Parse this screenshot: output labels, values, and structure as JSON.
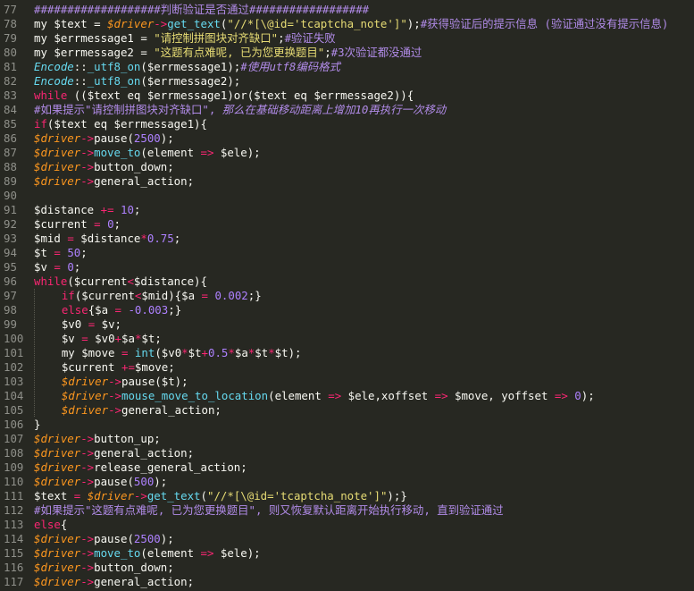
{
  "editor": {
    "colors": {
      "background": "#272822",
      "gutter_text": "#8f908a",
      "plain": "#f8f8f2",
      "keyword": "#f92672",
      "variable": "#fd971f",
      "string": "#e6db74",
      "number": "#ae81ff",
      "function": "#66d9ef",
      "comment": "#b18be8"
    },
    "lines": [
      {
        "n": "77",
        "tokens": [
          [
            "cm",
            "###################判断验证是否通过##################"
          ]
        ]
      },
      {
        "n": "78",
        "tokens": [
          [
            "plain",
            "my $text = "
          ],
          [
            "var",
            "$driver"
          ],
          [
            "kw",
            "->"
          ],
          [
            "fn",
            "get_text"
          ],
          [
            "plain",
            "("
          ],
          [
            "str",
            "\"//*[\\@id='tcaptcha_note']\""
          ],
          [
            "plain",
            ");"
          ],
          [
            "cm",
            "#获得验证后的提示信息 (验证通过没有提示信息)"
          ]
        ]
      },
      {
        "n": "79",
        "tokens": [
          [
            "plain",
            "my $errmessage1 = "
          ],
          [
            "str",
            "\"请控制拼图块对齐缺口\""
          ],
          [
            "plain",
            ";"
          ],
          [
            "cm",
            "#验证失败"
          ]
        ]
      },
      {
        "n": "80",
        "tokens": [
          [
            "plain",
            "my $errmessage2 = "
          ],
          [
            "str",
            "\"这题有点难呢, 已为您更换题目\""
          ],
          [
            "plain",
            ";"
          ],
          [
            "cm",
            "#3次验证都没通过"
          ]
        ]
      },
      {
        "n": "81",
        "tokens": [
          [
            "cls",
            "Encode"
          ],
          [
            "plain",
            "::"
          ],
          [
            "fn",
            "_utf8_on"
          ],
          [
            "plain",
            "($errmessage1);"
          ],
          [
            "cmi",
            "#使用utf8编码格式"
          ]
        ]
      },
      {
        "n": "82",
        "tokens": [
          [
            "cls",
            "Encode"
          ],
          [
            "plain",
            "::"
          ],
          [
            "fn",
            "_utf8_on"
          ],
          [
            "plain",
            "($errmessage2);"
          ]
        ]
      },
      {
        "n": "83",
        "tokens": [
          [
            "kw",
            "while"
          ],
          [
            "plain",
            " (($text eq $errmessage1)or($text eq $errmessage2)){"
          ]
        ]
      },
      {
        "n": "84",
        "tokens": [
          [
            "cm",
            "#如果提示\"请控制拼图块对齐缺口\", "
          ],
          [
            "cmi",
            "那么在基础移动距离上增加10再执行一次移动"
          ]
        ]
      },
      {
        "n": "85",
        "tokens": [
          [
            "kw",
            "if"
          ],
          [
            "plain",
            "($text eq $errmessage1){"
          ]
        ]
      },
      {
        "n": "86",
        "tokens": [
          [
            "var",
            "$driver"
          ],
          [
            "kw",
            "->"
          ],
          [
            "plain",
            "pause("
          ],
          [
            "num",
            "2500"
          ],
          [
            "plain",
            ");"
          ]
        ]
      },
      {
        "n": "87",
        "tokens": [
          [
            "var",
            "$driver"
          ],
          [
            "kw",
            "->"
          ],
          [
            "fn",
            "move_to"
          ],
          [
            "plain",
            "(element "
          ],
          [
            "kw",
            "=>"
          ],
          [
            "plain",
            " $ele);"
          ]
        ]
      },
      {
        "n": "88",
        "tokens": [
          [
            "var",
            "$driver"
          ],
          [
            "kw",
            "->"
          ],
          [
            "plain",
            "button_down;"
          ]
        ]
      },
      {
        "n": "89",
        "tokens": [
          [
            "var",
            "$driver"
          ],
          [
            "kw",
            "->"
          ],
          [
            "plain",
            "general_action;"
          ]
        ]
      },
      {
        "n": "90",
        "tokens": []
      },
      {
        "n": "91",
        "tokens": [
          [
            "plain",
            "$distance "
          ],
          [
            "kw",
            "+="
          ],
          [
            "plain",
            " "
          ],
          [
            "num",
            "10"
          ],
          [
            "plain",
            ";"
          ]
        ]
      },
      {
        "n": "92",
        "tokens": [
          [
            "plain",
            "$current "
          ],
          [
            "kw",
            "="
          ],
          [
            "plain",
            " "
          ],
          [
            "num",
            "0"
          ],
          [
            "plain",
            ";"
          ]
        ]
      },
      {
        "n": "93",
        "tokens": [
          [
            "plain",
            "$mid "
          ],
          [
            "kw",
            "="
          ],
          [
            "plain",
            " $distance"
          ],
          [
            "kw",
            "*"
          ],
          [
            "num",
            "0.75"
          ],
          [
            "plain",
            ";"
          ]
        ]
      },
      {
        "n": "94",
        "tokens": [
          [
            "plain",
            "$t "
          ],
          [
            "kw",
            "="
          ],
          [
            "plain",
            " "
          ],
          [
            "num",
            "50"
          ],
          [
            "plain",
            ";"
          ]
        ]
      },
      {
        "n": "95",
        "tokens": [
          [
            "plain",
            "$v "
          ],
          [
            "kw",
            "="
          ],
          [
            "plain",
            " "
          ],
          [
            "num",
            "0"
          ],
          [
            "plain",
            ";"
          ]
        ]
      },
      {
        "n": "96",
        "tokens": [
          [
            "kw",
            "while"
          ],
          [
            "plain",
            "($current"
          ],
          [
            "kw",
            "<"
          ],
          [
            "plain",
            "$distance){"
          ]
        ]
      },
      {
        "n": "97",
        "indent": 1,
        "tokens": [
          [
            "kw",
            "if"
          ],
          [
            "plain",
            "($current"
          ],
          [
            "kw",
            "<"
          ],
          [
            "plain",
            "$mid){$a "
          ],
          [
            "kw",
            "="
          ],
          [
            "plain",
            " "
          ],
          [
            "num",
            "0.002"
          ],
          [
            "plain",
            ";}"
          ]
        ]
      },
      {
        "n": "98",
        "indent": 1,
        "tokens": [
          [
            "kw",
            "else"
          ],
          [
            "plain",
            "{$a "
          ],
          [
            "kw",
            "="
          ],
          [
            "plain",
            " "
          ],
          [
            "num",
            "-0.003"
          ],
          [
            "plain",
            ";}"
          ]
        ]
      },
      {
        "n": "99",
        "indent": 1,
        "tokens": [
          [
            "plain",
            "$v0 "
          ],
          [
            "kw",
            "="
          ],
          [
            "plain",
            " $v;"
          ]
        ]
      },
      {
        "n": "100",
        "indent": 1,
        "tokens": [
          [
            "plain",
            "$v "
          ],
          [
            "kw",
            "="
          ],
          [
            "plain",
            " $v0"
          ],
          [
            "kw",
            "+"
          ],
          [
            "plain",
            "$a"
          ],
          [
            "kw",
            "*"
          ],
          [
            "plain",
            "$t;"
          ]
        ]
      },
      {
        "n": "101",
        "indent": 1,
        "tokens": [
          [
            "plain",
            "my $move "
          ],
          [
            "kw",
            "="
          ],
          [
            "plain",
            " "
          ],
          [
            "fn",
            "int"
          ],
          [
            "plain",
            "($v0"
          ],
          [
            "kw",
            "*"
          ],
          [
            "plain",
            "$t"
          ],
          [
            "kw",
            "+"
          ],
          [
            "num",
            "0.5"
          ],
          [
            "kw",
            "*"
          ],
          [
            "plain",
            "$a"
          ],
          [
            "kw",
            "*"
          ],
          [
            "plain",
            "$t"
          ],
          [
            "kw",
            "*"
          ],
          [
            "plain",
            "$t);"
          ]
        ]
      },
      {
        "n": "102",
        "indent": 1,
        "tokens": [
          [
            "plain",
            "$current "
          ],
          [
            "kw",
            "+="
          ],
          [
            "plain",
            "$move;"
          ]
        ]
      },
      {
        "n": "103",
        "indent": 1,
        "tokens": [
          [
            "var",
            "$driver"
          ],
          [
            "kw",
            "->"
          ],
          [
            "plain",
            "pause($t);"
          ]
        ]
      },
      {
        "n": "104",
        "indent": 1,
        "tokens": [
          [
            "var",
            "$driver"
          ],
          [
            "kw",
            "->"
          ],
          [
            "fn",
            "mouse_move_to_location"
          ],
          [
            "plain",
            "(element "
          ],
          [
            "kw",
            "=>"
          ],
          [
            "plain",
            " $ele,xoffset "
          ],
          [
            "kw",
            "=>"
          ],
          [
            "plain",
            " $move, yoffset "
          ],
          [
            "kw",
            "=>"
          ],
          [
            "plain",
            " "
          ],
          [
            "num",
            "0"
          ],
          [
            "plain",
            ");"
          ]
        ]
      },
      {
        "n": "105",
        "indent": 1,
        "tokens": [
          [
            "var",
            "$driver"
          ],
          [
            "kw",
            "->"
          ],
          [
            "plain",
            "general_action;"
          ]
        ]
      },
      {
        "n": "106",
        "tokens": [
          [
            "plain",
            "}"
          ]
        ]
      },
      {
        "n": "107",
        "tokens": [
          [
            "var",
            "$driver"
          ],
          [
            "kw",
            "->"
          ],
          [
            "plain",
            "button_up;"
          ]
        ]
      },
      {
        "n": "108",
        "tokens": [
          [
            "var",
            "$driver"
          ],
          [
            "kw",
            "->"
          ],
          [
            "plain",
            "general_action;"
          ]
        ]
      },
      {
        "n": "109",
        "tokens": [
          [
            "var",
            "$driver"
          ],
          [
            "kw",
            "->"
          ],
          [
            "plain",
            "release_general_action;"
          ]
        ]
      },
      {
        "n": "110",
        "tokens": [
          [
            "var",
            "$driver"
          ],
          [
            "kw",
            "->"
          ],
          [
            "plain",
            "pause("
          ],
          [
            "num",
            "500"
          ],
          [
            "plain",
            ");"
          ]
        ]
      },
      {
        "n": "111",
        "tokens": [
          [
            "plain",
            "$text "
          ],
          [
            "kw",
            "="
          ],
          [
            "plain",
            " "
          ],
          [
            "var",
            "$driver"
          ],
          [
            "kw",
            "->"
          ],
          [
            "fn",
            "get_text"
          ],
          [
            "plain",
            "("
          ],
          [
            "str",
            "\"//*[\\@id='tcaptcha_note']\""
          ],
          [
            "plain",
            ");}"
          ]
        ]
      },
      {
        "n": "112",
        "tokens": [
          [
            "cm",
            "#如果提示\"这题有点难呢, 已为您更换题目\", 则又恢复默认距离开始执行移动, 直到验证通过"
          ]
        ]
      },
      {
        "n": "113",
        "tokens": [
          [
            "kw",
            "else"
          ],
          [
            "plain",
            "{"
          ]
        ]
      },
      {
        "n": "114",
        "tokens": [
          [
            "var",
            "$driver"
          ],
          [
            "kw",
            "->"
          ],
          [
            "plain",
            "pause("
          ],
          [
            "num",
            "2500"
          ],
          [
            "plain",
            ");"
          ]
        ]
      },
      {
        "n": "115",
        "tokens": [
          [
            "var",
            "$driver"
          ],
          [
            "kw",
            "->"
          ],
          [
            "fn",
            "move_to"
          ],
          [
            "plain",
            "(element "
          ],
          [
            "kw",
            "=>"
          ],
          [
            "plain",
            " $ele);"
          ]
        ]
      },
      {
        "n": "116",
        "tokens": [
          [
            "var",
            "$driver"
          ],
          [
            "kw",
            "->"
          ],
          [
            "plain",
            "button_down;"
          ]
        ]
      },
      {
        "n": "117",
        "tokens": [
          [
            "var",
            "$driver"
          ],
          [
            "kw",
            "->"
          ],
          [
            "plain",
            "general_action;"
          ]
        ]
      }
    ]
  }
}
